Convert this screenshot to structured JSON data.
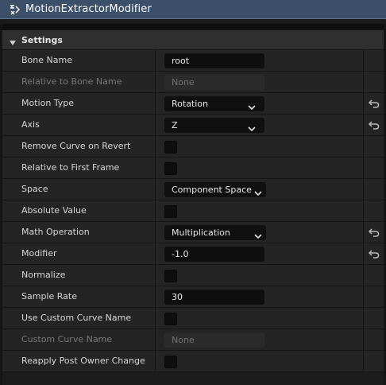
{
  "title": "MotionExtractorModifier",
  "section": {
    "label": "Settings"
  },
  "rows": [
    {
      "label": "Bone Name",
      "kind": "text",
      "value": "root",
      "disabled": false,
      "reset": false
    },
    {
      "label": "Relative to Bone Name",
      "kind": "text",
      "value": "None",
      "disabled": true,
      "reset": false
    },
    {
      "label": "Motion Type",
      "kind": "combo",
      "value": "Rotation",
      "disabled": false,
      "reset": true
    },
    {
      "label": "Axis",
      "kind": "combo",
      "value": "Z",
      "disabled": false,
      "reset": true
    },
    {
      "label": "Remove Curve on Revert",
      "kind": "checkbox",
      "checked": false,
      "disabled": false,
      "reset": false
    },
    {
      "label": "Relative to First Frame",
      "kind": "checkbox",
      "checked": false,
      "disabled": false,
      "reset": false
    },
    {
      "label": "Space",
      "kind": "combo",
      "value": "Component Space",
      "disabled": false,
      "reset": false
    },
    {
      "label": "Absolute Value",
      "kind": "checkbox",
      "checked": false,
      "disabled": false,
      "reset": false
    },
    {
      "label": "Math Operation",
      "kind": "combo",
      "value": "Multiplication",
      "disabled": false,
      "reset": true
    },
    {
      "label": "Modifier",
      "kind": "text",
      "value": "-1.0",
      "disabled": false,
      "reset": true
    },
    {
      "label": "Normalize",
      "kind": "checkbox",
      "checked": false,
      "disabled": false,
      "reset": false
    },
    {
      "label": "Sample Rate",
      "kind": "text",
      "value": "30",
      "disabled": false,
      "reset": false
    },
    {
      "label": "Use Custom Curve Name",
      "kind": "checkbox",
      "checked": false,
      "disabled": false,
      "reset": false
    },
    {
      "label": "Custom Curve Name",
      "kind": "text",
      "value": "None",
      "disabled": true,
      "reset": false
    },
    {
      "label": "Reapply Post Owner Change",
      "kind": "checkbox",
      "checked": false,
      "disabled": false,
      "reset": false
    }
  ],
  "icons": {
    "title": "modifier-icon",
    "caret": "caret-down-icon",
    "chevron": "chevron-down-icon",
    "reset": "reset-to-default-icon"
  },
  "colors": {
    "titlebar": "#3b4f68",
    "panel": "#242424",
    "input": "#0e0e0e"
  }
}
